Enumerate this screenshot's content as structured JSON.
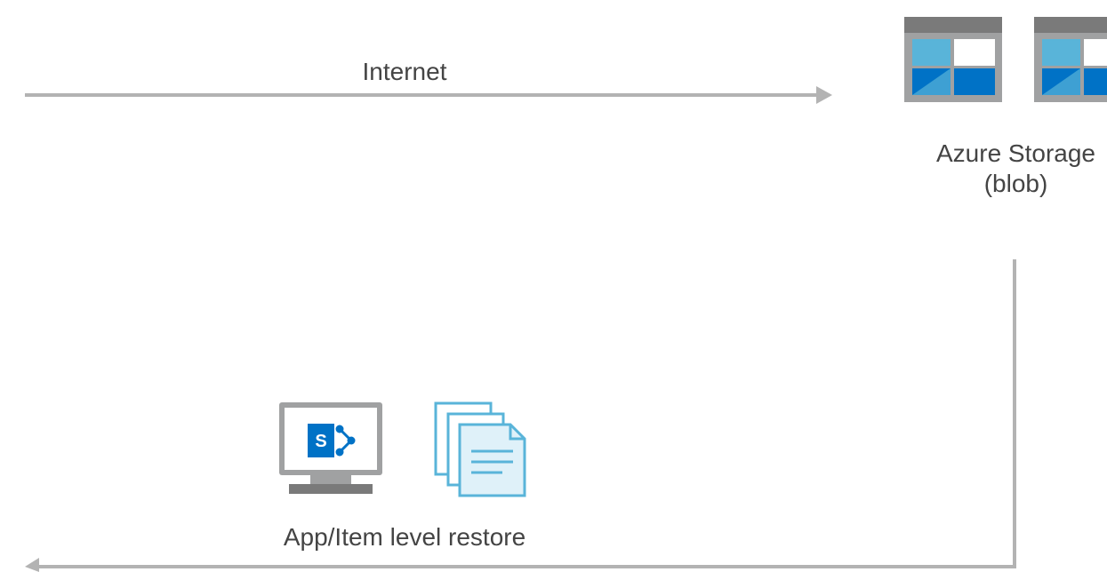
{
  "diagram": {
    "internet_label": "Internet",
    "storage": {
      "label_line1": "Azure Storage",
      "label_line2": "(blob)",
      "icon": "azure-storage-blob-icon"
    },
    "restore": {
      "label": "App/Item level restore",
      "icons": [
        "sharepoint-monitor-icon",
        "documents-icon"
      ]
    },
    "colors": {
      "arrow": "#b3b3b3",
      "blue_dark": "#0072c6",
      "blue_light": "#59b4d9",
      "gray_frame": "#a0a1a2",
      "text": "#444444"
    }
  }
}
